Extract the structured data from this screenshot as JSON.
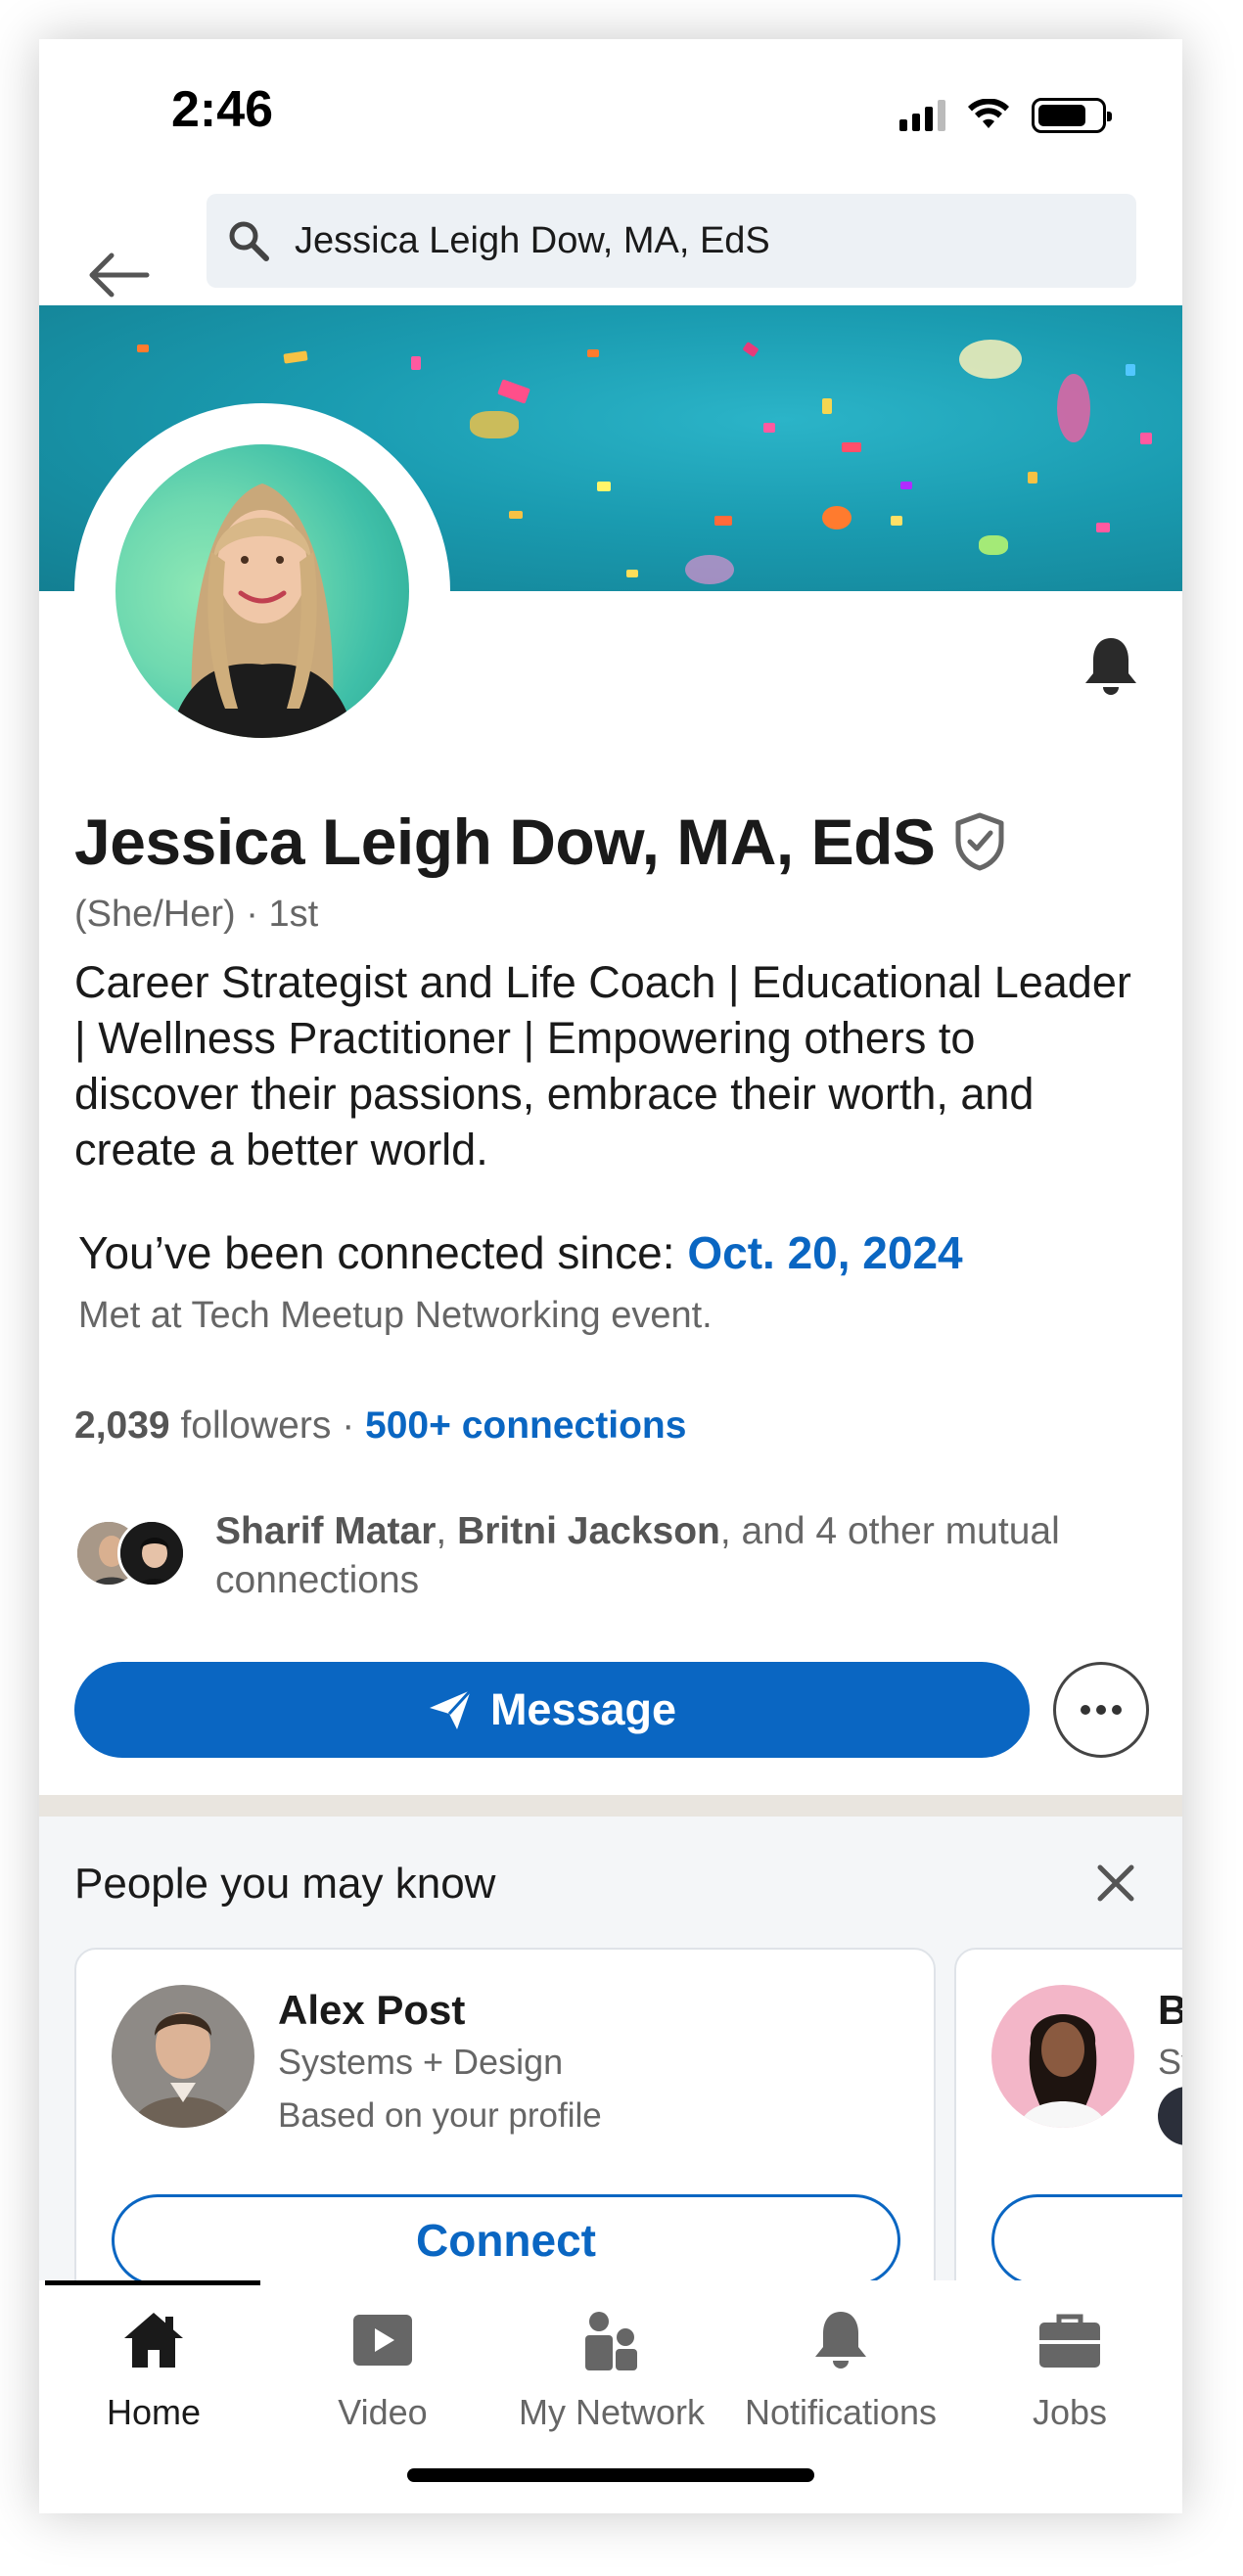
{
  "status_bar": {
    "time": "2:46"
  },
  "search": {
    "query": "Jessica Leigh Dow, MA, EdS"
  },
  "profile": {
    "name": "Jessica Leigh Dow, MA, EdS",
    "pronouns": "(She/Her)",
    "degree": "· 1st",
    "headline": "Career Strategist and Life Coach | Educational Leader | Wellness Practitioner | Empowering others to discover their passions, embrace their worth, and create a better world.",
    "connected_label": "You’ve been connected since:",
    "connected_date": "Oct. 20, 2024",
    "met_note": "Met at Tech Meetup Networking event.",
    "followers_count": "2,039",
    "followers_label": "followers",
    "stats_separator": "·",
    "connections": "500+ connections",
    "mutual": {
      "person_1": "Sharif Matar",
      "separator": ",",
      "person_2": "Britni Jackson",
      "rest": ", and 4 other mutual connections"
    },
    "message_label": "Message"
  },
  "people_you_may_know": {
    "title": "People you may know",
    "cards": [
      {
        "name": "Alex Post",
        "title": "Systems + Design",
        "reason": "Based on your profile",
        "button": "Connect"
      },
      {
        "name": "B",
        "title": "Sy"
      }
    ]
  },
  "bottom_nav": {
    "items": [
      {
        "label": "Home",
        "icon": "home-icon",
        "active": true
      },
      {
        "label": "Video",
        "icon": "video-icon"
      },
      {
        "label": "My Network",
        "icon": "my-network-icon"
      },
      {
        "label": "Notifications",
        "icon": "bell-icon"
      },
      {
        "label": "Jobs",
        "icon": "briefcase-icon"
      }
    ]
  },
  "colors": {
    "brand_blue": "#0a66c2",
    "banner_teal": "#1a9bb0",
    "divider": "#e9e5df"
  }
}
